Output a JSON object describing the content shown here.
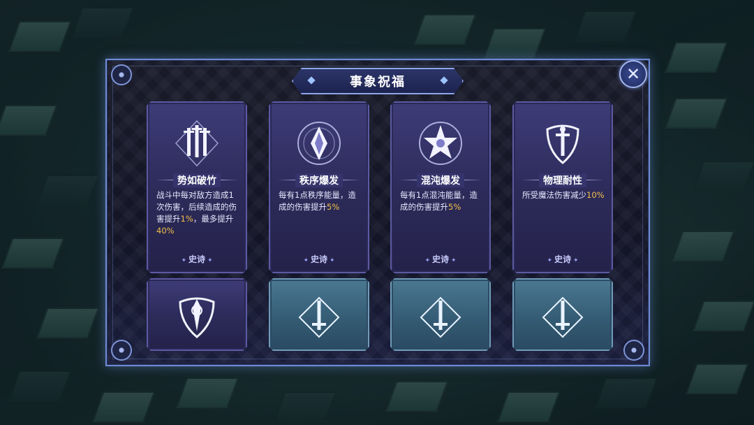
{
  "dialog": {
    "title": "事象祝福",
    "close_icon": "close-icon"
  },
  "cards": [
    {
      "name": "势如破竹",
      "icon": "swords-icon",
      "desc_parts": [
        "战斗中每对敌方造成1次伤害，后续造成的伤害提升",
        "1%",
        "，最多提升",
        "40%"
      ],
      "rarity": "史诗"
    },
    {
      "name": "秩序爆发",
      "icon": "order-crystal-icon",
      "desc_parts": [
        "每有1点秩序能量，造成的伤害提升",
        "5%"
      ],
      "rarity": "史诗"
    },
    {
      "name": "混沌爆发",
      "icon": "chaos-star-icon",
      "desc_parts": [
        "每有1点混沌能量，造成的伤害提升",
        "5%"
      ],
      "rarity": "史诗"
    },
    {
      "name": "物理耐性",
      "icon": "sword-shield-icon",
      "desc_parts": [
        "所受魔法伤害减少",
        "10%"
      ],
      "rarity": "史诗"
    }
  ],
  "lower_cards": [
    {
      "icon": "ornate-shield-icon",
      "tone": "purple"
    },
    {
      "icon": "sword-diamond-icon",
      "tone": "teal"
    },
    {
      "icon": "sword-diamond-icon",
      "tone": "teal"
    },
    {
      "icon": "sword-diamond-icon",
      "tone": "teal"
    }
  ],
  "colors": {
    "highlight": "#f2c04a",
    "card_purple": "#3d3c78",
    "card_teal": "#4b7892",
    "frame": "#6f8bd3"
  }
}
